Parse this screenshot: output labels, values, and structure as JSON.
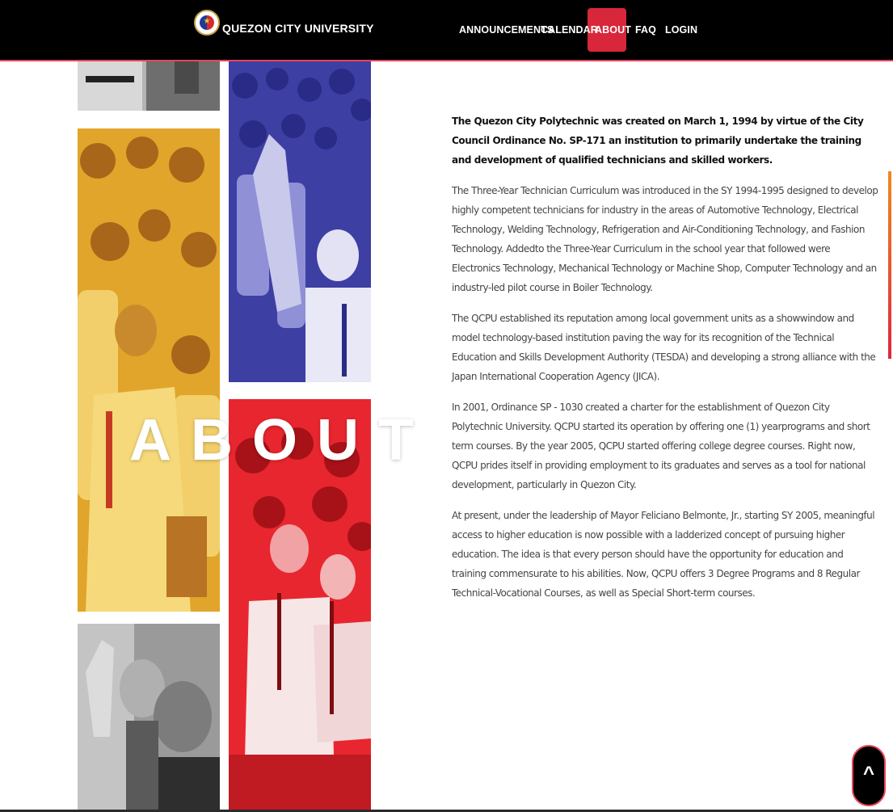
{
  "navbar": {
    "brand": "QUEZON CITY UNIVERSITY",
    "items": [
      {
        "label": "ANNOUNCEMENTS",
        "active": false
      },
      {
        "label": "CALENDAR",
        "active": false
      },
      {
        "label": "ABOUT",
        "active": true
      },
      {
        "label": "FAQ",
        "active": false
      },
      {
        "label": "LOGIN",
        "active": false
      }
    ],
    "active_color": "#d8273a"
  },
  "hero": {
    "title": "ABOUT"
  },
  "content": {
    "paragraphs": [
      "The Quezon City Polytechnic was created on March 1, 1994 by virtue of the City Council Ordinance No. SP-171 an institution to primarily undertake the training and development of qualified technicians and skilled workers.",
      "The Three-Year Technician Curriculum was introduced in the SY 1994-1995 designed to develop highly competent technicians for industry in the areas of Automotive Technology, Electrical Technology, Welding Technology, Refrigeration and Air-Conditioning Technology, and Fashion Technology. Addedto the Three-Year Curriculum in the school year that followed were Electronics Technology, Mechanical Technology or Machine Shop, Computer Technology and an industry-led pilot course in Boiler Technology.",
      "The QCPU established its reputation among local government units as a showwindow and model technology-based institution paving the way for its recognition of the Technical Education and Skills Development Authority (TESDA) and developing a strong alliance with the Japan International Cooperation Agency (JICA).",
      "In 2001, Ordinance SP - 1030 created a charter for the establishment of Quezon City Polytechnic University. QCPU started its operation by offering one (1) yearprograms and short term courses. By the year 2005, QCPU started offering college degree courses. Right now, QCPU prides itself in providing employment to its graduates and serves as a tool for national development, particularly in Quezon City.",
      "At present, under the leadership of Mayor Feliciano Belmonte, Jr., starting SY 2005, meaningful access to higher education is now possible with a ladderized concept of pursuing higher education. The idea is that every person should have the opportunity for education and training commensurate to his abilities. Now, QCPU offers 3 Degree Programs and 8 Regular Technical-Vocational Courses, as well as Special Short-term courses."
    ]
  },
  "collage_colors": {
    "gray": "#8f8f8f",
    "blue": "#3d3fa3",
    "yellow": "#e0a52a",
    "red": "#e8262f"
  },
  "icons": {
    "back_to_top": "chevron-up-icon"
  }
}
